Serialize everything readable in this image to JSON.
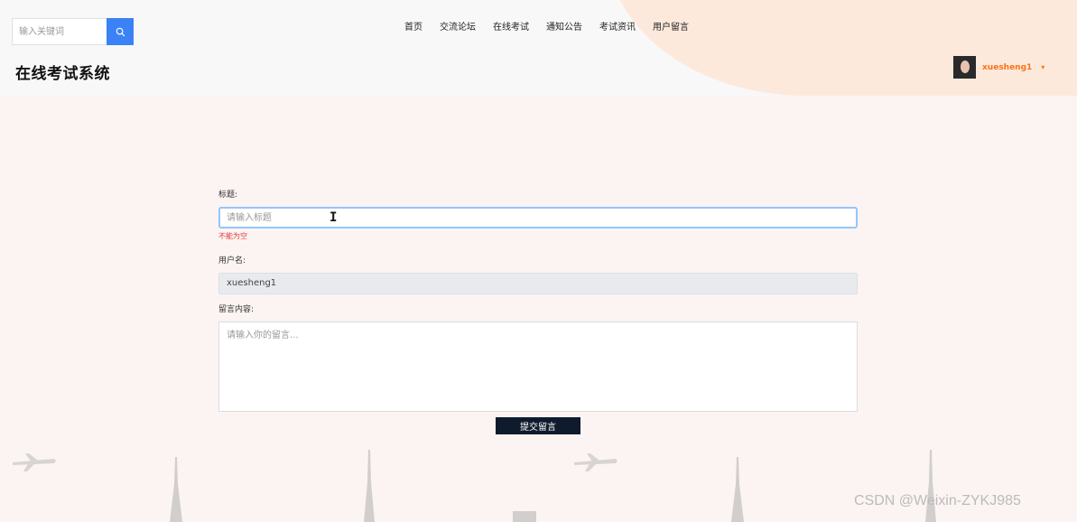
{
  "header": {
    "search": {
      "placeholder": "输入关键词",
      "icon": "search-icon"
    },
    "nav": [
      "首页",
      "交流论坛",
      "在线考试",
      "通知公告",
      "考试资讯",
      "用户留言"
    ],
    "site_title": "在线考试系统",
    "user": {
      "name": "xuesheng1",
      "caret": "▾"
    }
  },
  "form": {
    "title_label": "标题:",
    "title_placeholder": "请输入标题",
    "title_error": "不能为空",
    "username_label": "用户名:",
    "username_value": "xuesheng1",
    "message_label": "留言内容:",
    "message_placeholder": "请输入你的留言...",
    "submit_label": "提交留言"
  },
  "watermark": "CSDN @Weixin-ZYKJ985",
  "colors": {
    "accent": "#3b82f6",
    "user_orange": "#f97316",
    "error": "#e53935",
    "submit_bg": "#0f1b2d"
  }
}
